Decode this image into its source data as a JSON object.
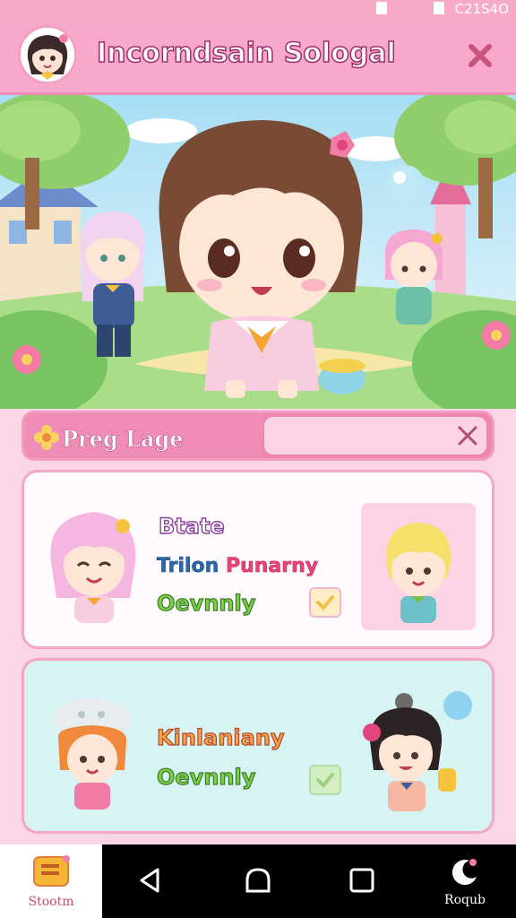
{
  "status_bar": {
    "time": "C21S4O"
  },
  "header": {
    "title": "Incorndsain Sologal"
  },
  "search": {
    "label": "Preg Lage",
    "value": ""
  },
  "cards": [
    {
      "state": "Btate",
      "name_part1": "Trilon",
      "name_part2": "Punarny",
      "status": "Oevnnly"
    },
    {
      "title": "Kinlaniany",
      "status": "Oevnnly"
    }
  ],
  "bottom_nav": {
    "home_label": "Stootm",
    "right_label": "Roqub"
  },
  "colors": {
    "header_pink": "#f8a9cb",
    "card_mint": "#d8f3f3",
    "accent_pink": "#ee86b2"
  }
}
